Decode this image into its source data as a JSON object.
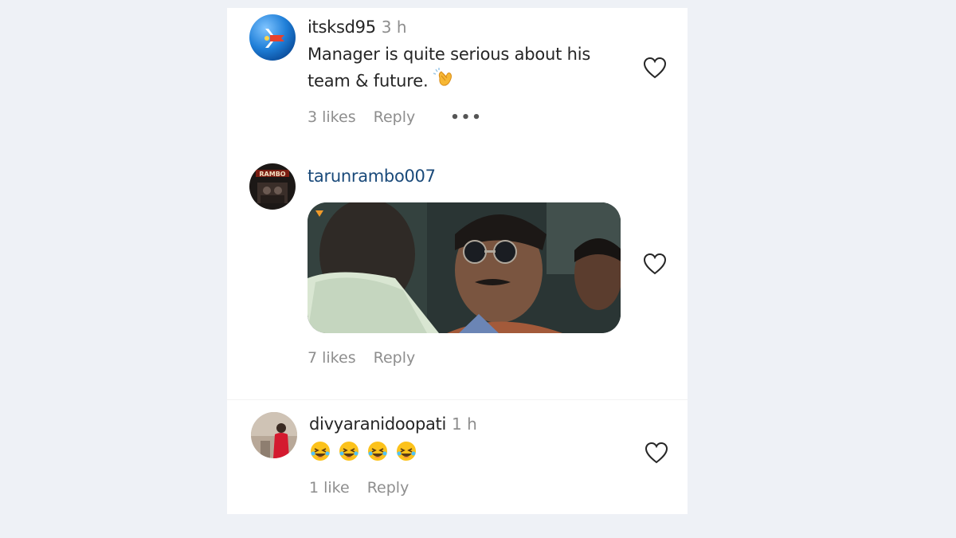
{
  "comments": [
    {
      "username": "itsksd95",
      "time": "3 h",
      "text_line1": "Manager is quite serious about his",
      "text_line2": "team & future.",
      "text_emoji": "clapping-hands",
      "likes": "3 likes",
      "reply": "Reply",
      "more": "•••"
    },
    {
      "username": "tarunrambo007",
      "media": "gif",
      "likes": "7 likes",
      "reply": "Reply"
    },
    {
      "username": "divyaranidoopati",
      "time": "1 h",
      "emojis": [
        "rolling-on-floor-laughing",
        "rolling-on-floor-laughing",
        "rolling-on-floor-laughing",
        "rolling-on-floor-laughing"
      ],
      "likes": "1 like",
      "reply": "Reply"
    }
  ],
  "icons": {
    "heart": "heart-outline-icon",
    "more": "more-options-icon"
  },
  "colors": {
    "background": "#eef1f6",
    "panel": "#ffffff",
    "text": "#262626",
    "secondary": "#8e8e8e",
    "username_link": "#1a4a7a"
  }
}
